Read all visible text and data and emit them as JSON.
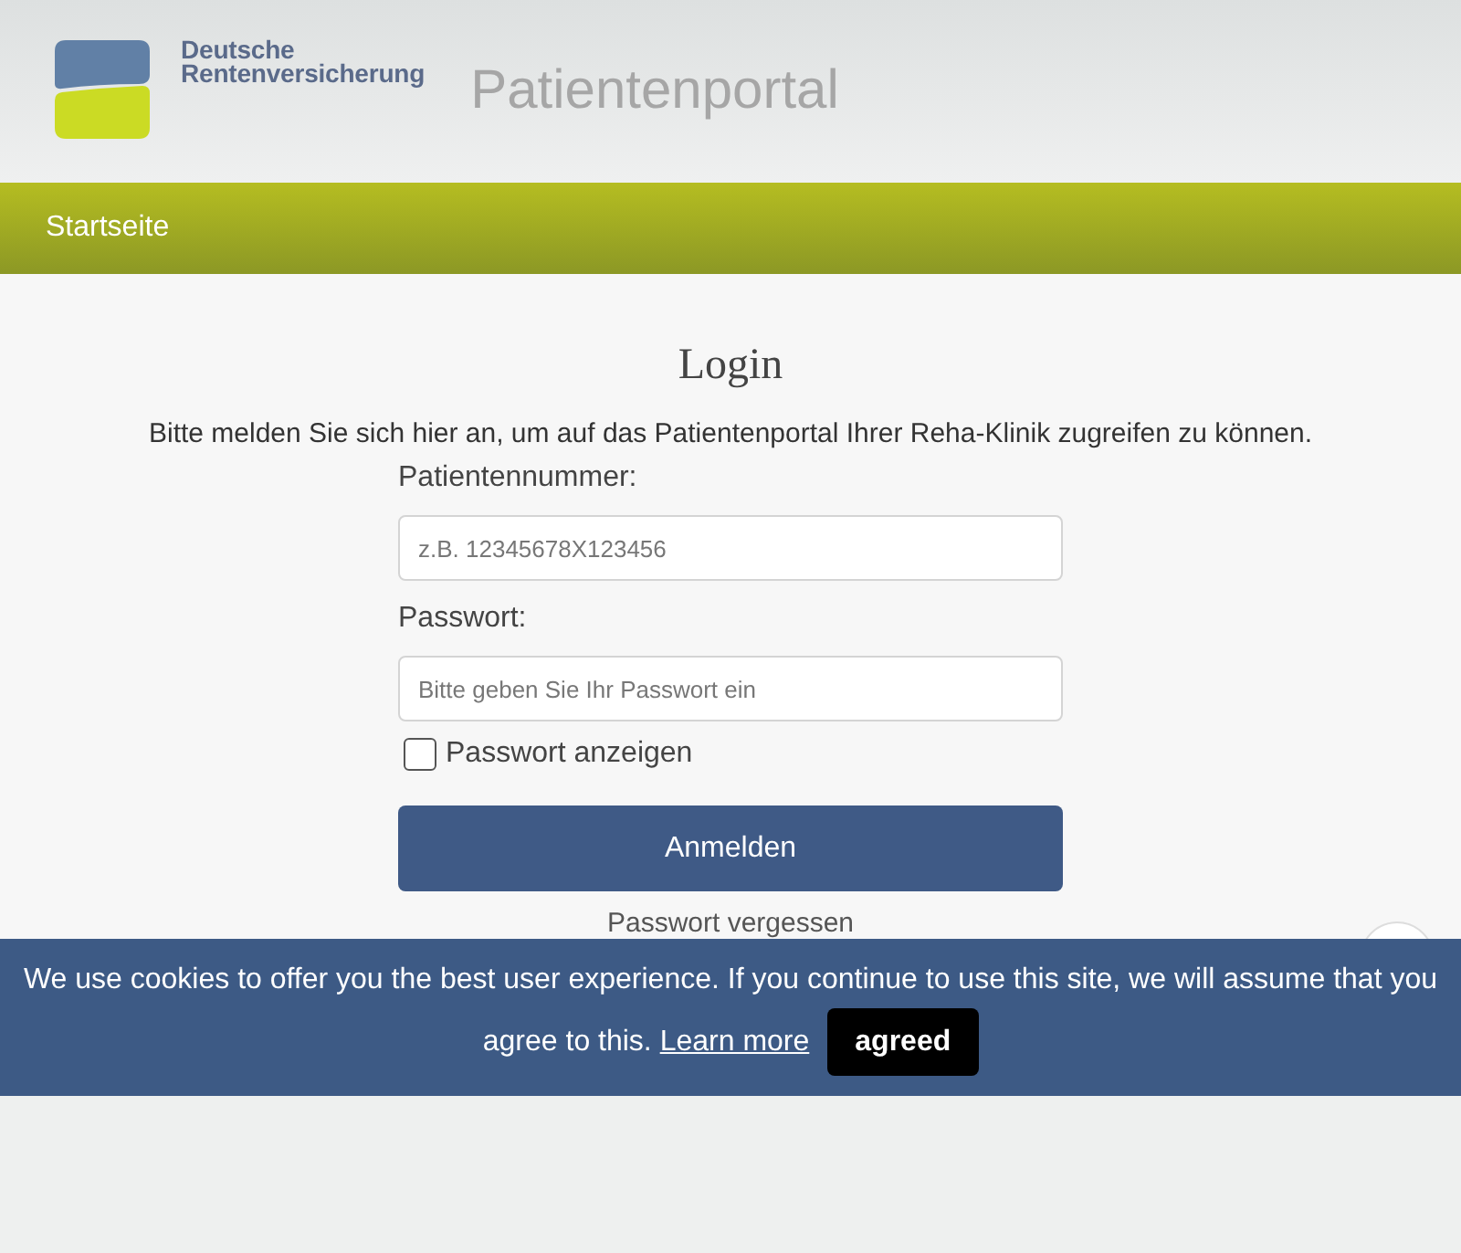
{
  "header": {
    "logo_lines": [
      "Deutsche",
      "Rentenversicherung"
    ],
    "portal_title": "Patientenportal"
  },
  "nav": {
    "items": [
      "Startseite"
    ]
  },
  "login": {
    "title": "Login",
    "intro": "Bitte melden Sie sich hier an, um auf das Patientenportal Ihrer Reha-Klinik zugreifen zu können.",
    "fields": [
      {
        "label": "Patientennummer:",
        "placeholder": "z.B. 12345678X123456"
      },
      {
        "label": "Passwort:",
        "placeholder": "Bitte geben Sie Ihr Passwort ein"
      }
    ],
    "show_password": {
      "label": "Passwort anzeigen",
      "checked": false
    },
    "submit": "Anmelden",
    "forgot_link": "Passwort vergessen"
  },
  "cookie_banner": {
    "message_lines": [
      "We use cookies to offer you the best user experience. If you continue to use this site, we will assume that you",
      "agree to this."
    ],
    "link": "Learn more",
    "button": "agreed"
  }
}
